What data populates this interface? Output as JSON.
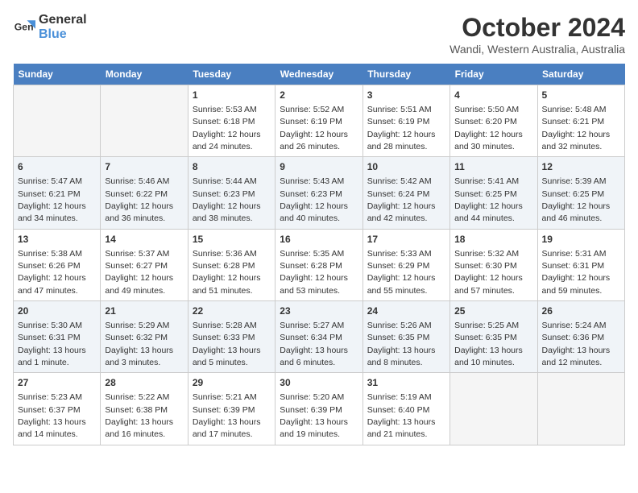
{
  "header": {
    "logo_general": "General",
    "logo_blue": "Blue",
    "title": "October 2024",
    "subtitle": "Wandi, Western Australia, Australia"
  },
  "days_of_week": [
    "Sunday",
    "Monday",
    "Tuesday",
    "Wednesday",
    "Thursday",
    "Friday",
    "Saturday"
  ],
  "weeks": [
    [
      {
        "day": "",
        "info": ""
      },
      {
        "day": "",
        "info": ""
      },
      {
        "day": "1",
        "info": "Sunrise: 5:53 AM\nSunset: 6:18 PM\nDaylight: 12 hours and 24 minutes."
      },
      {
        "day": "2",
        "info": "Sunrise: 5:52 AM\nSunset: 6:19 PM\nDaylight: 12 hours and 26 minutes."
      },
      {
        "day": "3",
        "info": "Sunrise: 5:51 AM\nSunset: 6:19 PM\nDaylight: 12 hours and 28 minutes."
      },
      {
        "day": "4",
        "info": "Sunrise: 5:50 AM\nSunset: 6:20 PM\nDaylight: 12 hours and 30 minutes."
      },
      {
        "day": "5",
        "info": "Sunrise: 5:48 AM\nSunset: 6:21 PM\nDaylight: 12 hours and 32 minutes."
      }
    ],
    [
      {
        "day": "6",
        "info": "Sunrise: 5:47 AM\nSunset: 6:21 PM\nDaylight: 12 hours and 34 minutes."
      },
      {
        "day": "7",
        "info": "Sunrise: 5:46 AM\nSunset: 6:22 PM\nDaylight: 12 hours and 36 minutes."
      },
      {
        "day": "8",
        "info": "Sunrise: 5:44 AM\nSunset: 6:23 PM\nDaylight: 12 hours and 38 minutes."
      },
      {
        "day": "9",
        "info": "Sunrise: 5:43 AM\nSunset: 6:23 PM\nDaylight: 12 hours and 40 minutes."
      },
      {
        "day": "10",
        "info": "Sunrise: 5:42 AM\nSunset: 6:24 PM\nDaylight: 12 hours and 42 minutes."
      },
      {
        "day": "11",
        "info": "Sunrise: 5:41 AM\nSunset: 6:25 PM\nDaylight: 12 hours and 44 minutes."
      },
      {
        "day": "12",
        "info": "Sunrise: 5:39 AM\nSunset: 6:25 PM\nDaylight: 12 hours and 46 minutes."
      }
    ],
    [
      {
        "day": "13",
        "info": "Sunrise: 5:38 AM\nSunset: 6:26 PM\nDaylight: 12 hours and 47 minutes."
      },
      {
        "day": "14",
        "info": "Sunrise: 5:37 AM\nSunset: 6:27 PM\nDaylight: 12 hours and 49 minutes."
      },
      {
        "day": "15",
        "info": "Sunrise: 5:36 AM\nSunset: 6:28 PM\nDaylight: 12 hours and 51 minutes."
      },
      {
        "day": "16",
        "info": "Sunrise: 5:35 AM\nSunset: 6:28 PM\nDaylight: 12 hours and 53 minutes."
      },
      {
        "day": "17",
        "info": "Sunrise: 5:33 AM\nSunset: 6:29 PM\nDaylight: 12 hours and 55 minutes."
      },
      {
        "day": "18",
        "info": "Sunrise: 5:32 AM\nSunset: 6:30 PM\nDaylight: 12 hours and 57 minutes."
      },
      {
        "day": "19",
        "info": "Sunrise: 5:31 AM\nSunset: 6:31 PM\nDaylight: 12 hours and 59 minutes."
      }
    ],
    [
      {
        "day": "20",
        "info": "Sunrise: 5:30 AM\nSunset: 6:31 PM\nDaylight: 13 hours and 1 minute."
      },
      {
        "day": "21",
        "info": "Sunrise: 5:29 AM\nSunset: 6:32 PM\nDaylight: 13 hours and 3 minutes."
      },
      {
        "day": "22",
        "info": "Sunrise: 5:28 AM\nSunset: 6:33 PM\nDaylight: 13 hours and 5 minutes."
      },
      {
        "day": "23",
        "info": "Sunrise: 5:27 AM\nSunset: 6:34 PM\nDaylight: 13 hours and 6 minutes."
      },
      {
        "day": "24",
        "info": "Sunrise: 5:26 AM\nSunset: 6:35 PM\nDaylight: 13 hours and 8 minutes."
      },
      {
        "day": "25",
        "info": "Sunrise: 5:25 AM\nSunset: 6:35 PM\nDaylight: 13 hours and 10 minutes."
      },
      {
        "day": "26",
        "info": "Sunrise: 5:24 AM\nSunset: 6:36 PM\nDaylight: 13 hours and 12 minutes."
      }
    ],
    [
      {
        "day": "27",
        "info": "Sunrise: 5:23 AM\nSunset: 6:37 PM\nDaylight: 13 hours and 14 minutes."
      },
      {
        "day": "28",
        "info": "Sunrise: 5:22 AM\nSunset: 6:38 PM\nDaylight: 13 hours and 16 minutes."
      },
      {
        "day": "29",
        "info": "Sunrise: 5:21 AM\nSunset: 6:39 PM\nDaylight: 13 hours and 17 minutes."
      },
      {
        "day": "30",
        "info": "Sunrise: 5:20 AM\nSunset: 6:39 PM\nDaylight: 13 hours and 19 minutes."
      },
      {
        "day": "31",
        "info": "Sunrise: 5:19 AM\nSunset: 6:40 PM\nDaylight: 13 hours and 21 minutes."
      },
      {
        "day": "",
        "info": ""
      },
      {
        "day": "",
        "info": ""
      }
    ]
  ]
}
